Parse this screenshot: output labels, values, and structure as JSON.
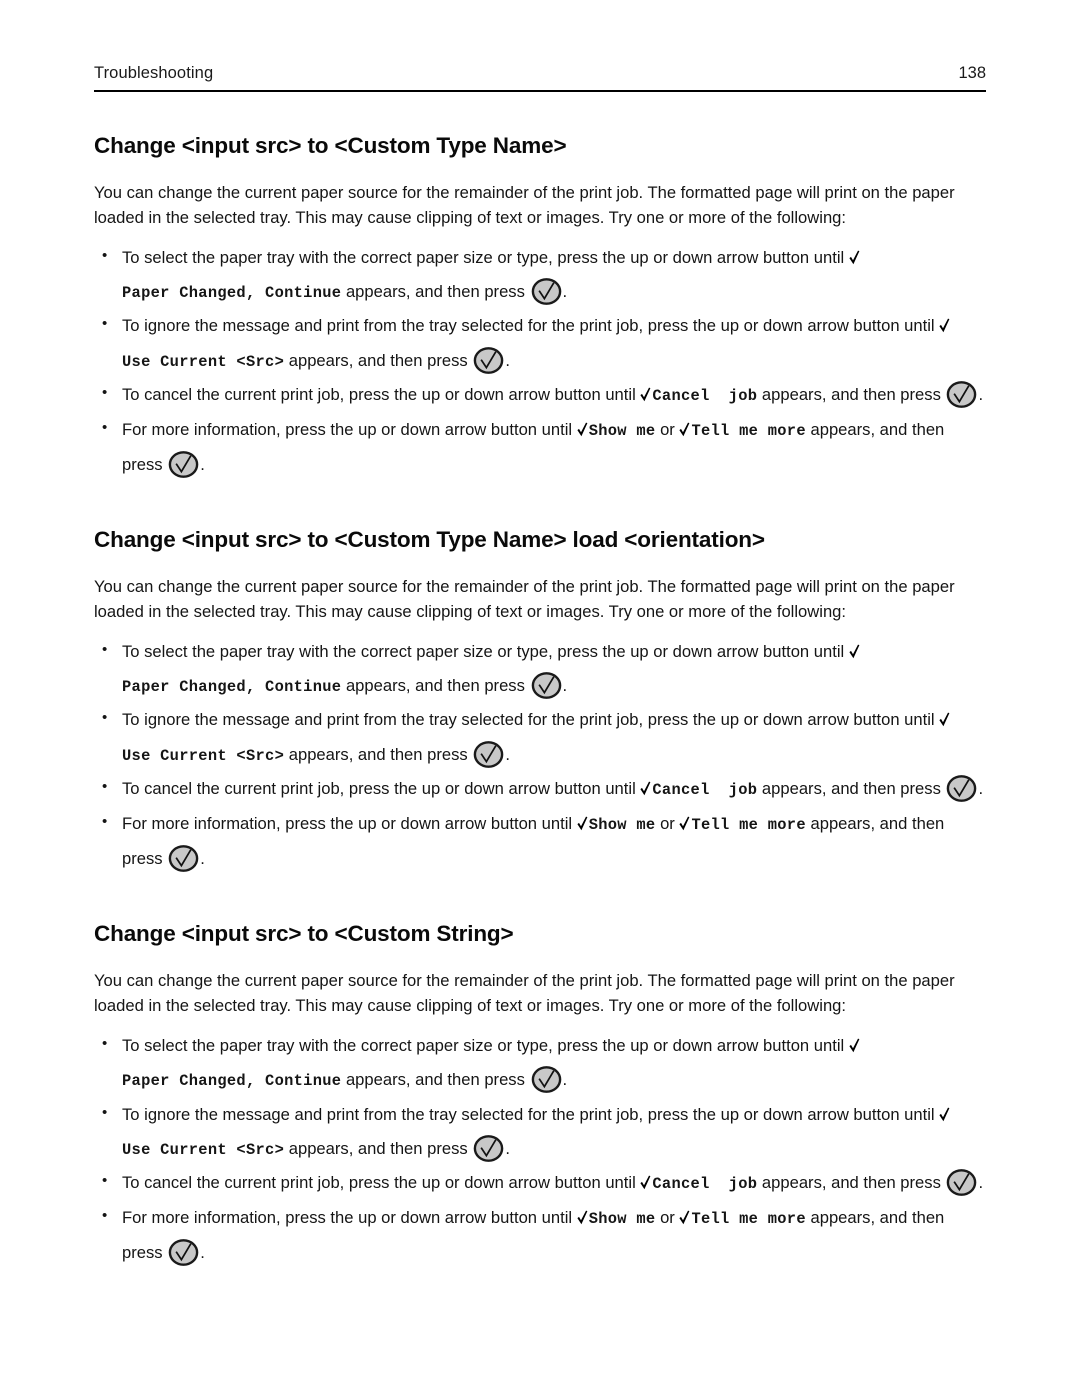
{
  "header": {
    "title": "Troubleshooting",
    "page_number": "138"
  },
  "icons": {
    "check_glyph": "check-glyph",
    "select_button": "select-ok-button-icon",
    "bullet_marker": "•"
  },
  "colors": {
    "text": "#151515",
    "heading": "#0a0a0a",
    "rule": "#000000",
    "button_fill": "#c8c8c8",
    "button_stroke": "#1a1a1a",
    "page_background": "#ffffff"
  },
  "sections": [
    {
      "heading": "Change <input src> to <Custom Type Name>",
      "intro": "You can change the current paper source for the remainder of the print job. The formatted page will print on the paper loaded in the selected tray. This may cause clipping of text or images. Try one or more of the following:",
      "bullets": [
        {
          "lead": "To select the paper tray with the correct paper size or type, press the up or down arrow button until ",
          "msg1": "Paper Changed, Continue",
          "mid": " appears, and then press ",
          "tail": "."
        },
        {
          "lead": "To ignore the message and print from the tray selected for the print job, press the up or down arrow button until ",
          "msg1": "Use Current <Src>",
          "mid": " appears, and then press ",
          "tail": "."
        },
        {
          "lead": "To cancel the current print job, press the up or down arrow button until ",
          "msg1": "Cancel  job",
          "mid": " appears, and then press ",
          "tail": "."
        },
        {
          "lead": "For more information, press the up or down arrow button until ",
          "msg1": "Show me",
          "conj": " or ",
          "msg2": "Tell me more",
          "mid": " appears, and then press ",
          "tail": "."
        }
      ]
    },
    {
      "heading": "Change <input src> to <Custom Type Name> load <orientation>",
      "intro": "You can change the current paper source for the remainder of the print job. The formatted page will print on the paper loaded in the selected tray. This may cause clipping of text or images. Try one or more of the following:",
      "bullets": [
        {
          "lead": "To select the paper tray with the correct paper size or type, press the up or down arrow button until ",
          "msg1": "Paper Changed, Continue",
          "mid": " appears, and then press ",
          "tail": "."
        },
        {
          "lead": "To ignore the message and print from the tray selected for the print job, press the up or down arrow button until ",
          "msg1": "Use Current <Src>",
          "mid": " appears, and then press ",
          "tail": "."
        },
        {
          "lead": "To cancel the current print job, press the up or down arrow button until ",
          "msg1": "Cancel  job",
          "mid": " appears, and then press ",
          "tail": "."
        },
        {
          "lead": "For more information, press the up or down arrow button until ",
          "msg1": "Show me",
          "conj": " or ",
          "msg2": "Tell me more",
          "mid": " appears, and then press ",
          "tail": "."
        }
      ]
    },
    {
      "heading": "Change <input src> to <Custom String>",
      "intro": "You can change the current paper source for the remainder of the print job. The formatted page will print on the paper loaded in the selected tray. This may cause clipping of text or images. Try one or more of the following:",
      "bullets": [
        {
          "lead": "To select the paper tray with the correct paper size or type, press the up or down arrow button until ",
          "msg1": "Paper Changed, Continue",
          "mid": " appears, and then press ",
          "tail": "."
        },
        {
          "lead": "To ignore the message and print from the tray selected for the print job, press the up or down arrow button until ",
          "msg1": "Use Current <Src>",
          "mid": " appears, and then press ",
          "tail": "."
        },
        {
          "lead": "To cancel the current print job, press the up or down arrow button until ",
          "msg1": "Cancel  job",
          "mid": " appears, and then press ",
          "tail": "."
        },
        {
          "lead": "For more information, press the up or down arrow button until ",
          "msg1": "Show me",
          "conj": " or ",
          "msg2": "Tell me more",
          "mid": " appears, and then press ",
          "tail": "."
        }
      ]
    }
  ]
}
